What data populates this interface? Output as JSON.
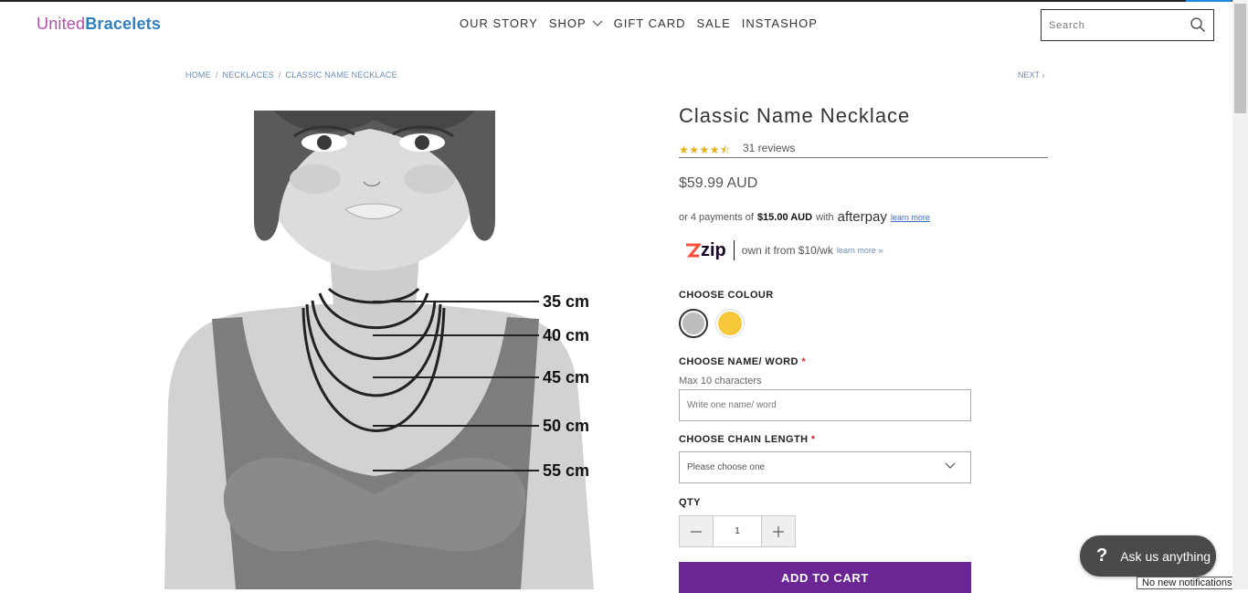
{
  "header": {
    "logo_part1": "United",
    "logo_part2": "Bracelets",
    "nav": [
      "OUR STORY",
      "SHOP",
      "GIFT CARD",
      "SALE",
      "INSTASHOP"
    ],
    "search_placeholder": "Search"
  },
  "breadcrumb": [
    "HOME",
    "NECKLACES",
    "CLASSIC NAME NECKLACE"
  ],
  "next_label": "NEXT",
  "product": {
    "title": "Classic Name Necklace",
    "rating": 4.5,
    "rating_stars": "★★★★⯪",
    "reviews": "31 reviews",
    "price": "$59.99 AUD",
    "afterpay_prefix": "or 4 payments of",
    "afterpay_amount": "$15.00 AUD",
    "afterpay_with": "with",
    "afterpay_brand": "afterpay",
    "afterpay_learn": "learn more",
    "zip_brand": "zip",
    "zip_text": "own it from $10/wk",
    "zip_learn": "learn more »"
  },
  "chart_labels": [
    "35 cm",
    "40 cm",
    "45 cm",
    "50 cm",
    "55 cm"
  ],
  "options": {
    "colour_label": "CHOOSE COLOUR",
    "colours": [
      {
        "name": "Silver",
        "hex": "#bdbdbd"
      },
      {
        "name": "Gold",
        "hex": "#f7c73a"
      }
    ],
    "name_label": "CHOOSE NAME/ WORD",
    "required_mark": "*",
    "name_hint": "Max 10 characters",
    "name_placeholder": "Write one name/ word",
    "chain_label": "CHOOSE CHAIN LENGTH",
    "chain_value": "Please choose one",
    "qty_label": "QTY",
    "qty_value": "1",
    "add_to_cart": "ADD TO CART"
  },
  "chat": {
    "icon": "?",
    "label": "Ask us anything"
  },
  "notification": "No new notifications",
  "colors": {
    "accent": "#6b2694",
    "logo_pink": "#b04fa6",
    "logo_blue": "#2f7fc0",
    "link": "#6c8ab5"
  }
}
